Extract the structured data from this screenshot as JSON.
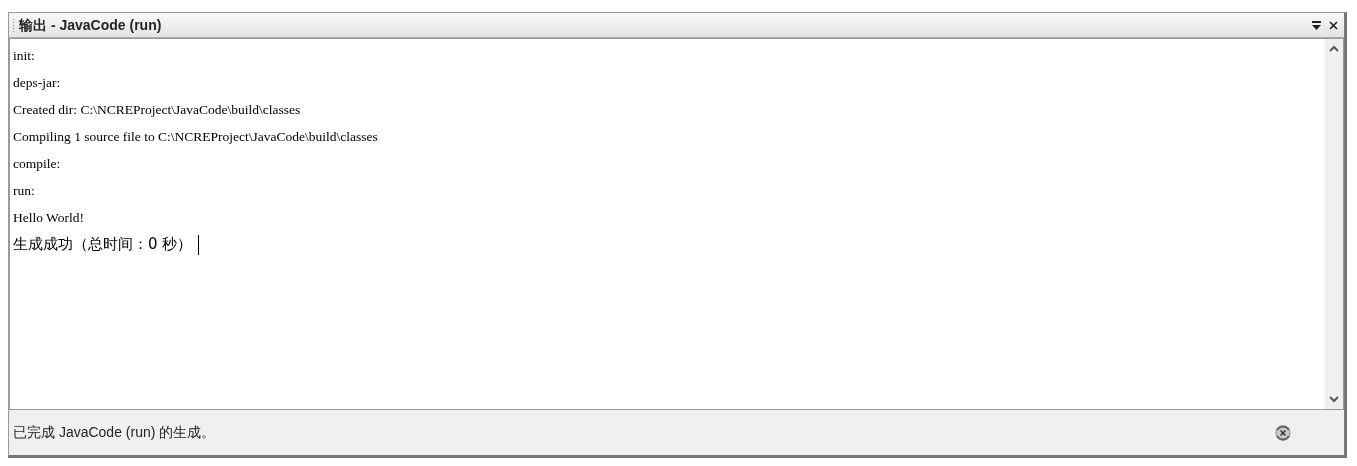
{
  "window": {
    "title": "输出 - JavaCode (run)"
  },
  "output_lines": [
    {
      "kind": "log",
      "text": "init:"
    },
    {
      "kind": "log",
      "text": "deps-jar:"
    },
    {
      "kind": "log",
      "text": "Created dir: C:\\NCREProject\\JavaCode\\build\\classes"
    },
    {
      "kind": "log",
      "text": "Compiling 1 source file to C:\\NCREProject\\JavaCode\\build\\classes"
    },
    {
      "kind": "log",
      "text": "compile:"
    },
    {
      "kind": "log",
      "text": "run:"
    },
    {
      "kind": "log",
      "text": "Hello World!"
    },
    {
      "kind": "result",
      "text": "生成成功（总时间：0 秒）"
    }
  ],
  "status_bar": {
    "text": "已完成 JavaCode (run) 的生成。"
  }
}
